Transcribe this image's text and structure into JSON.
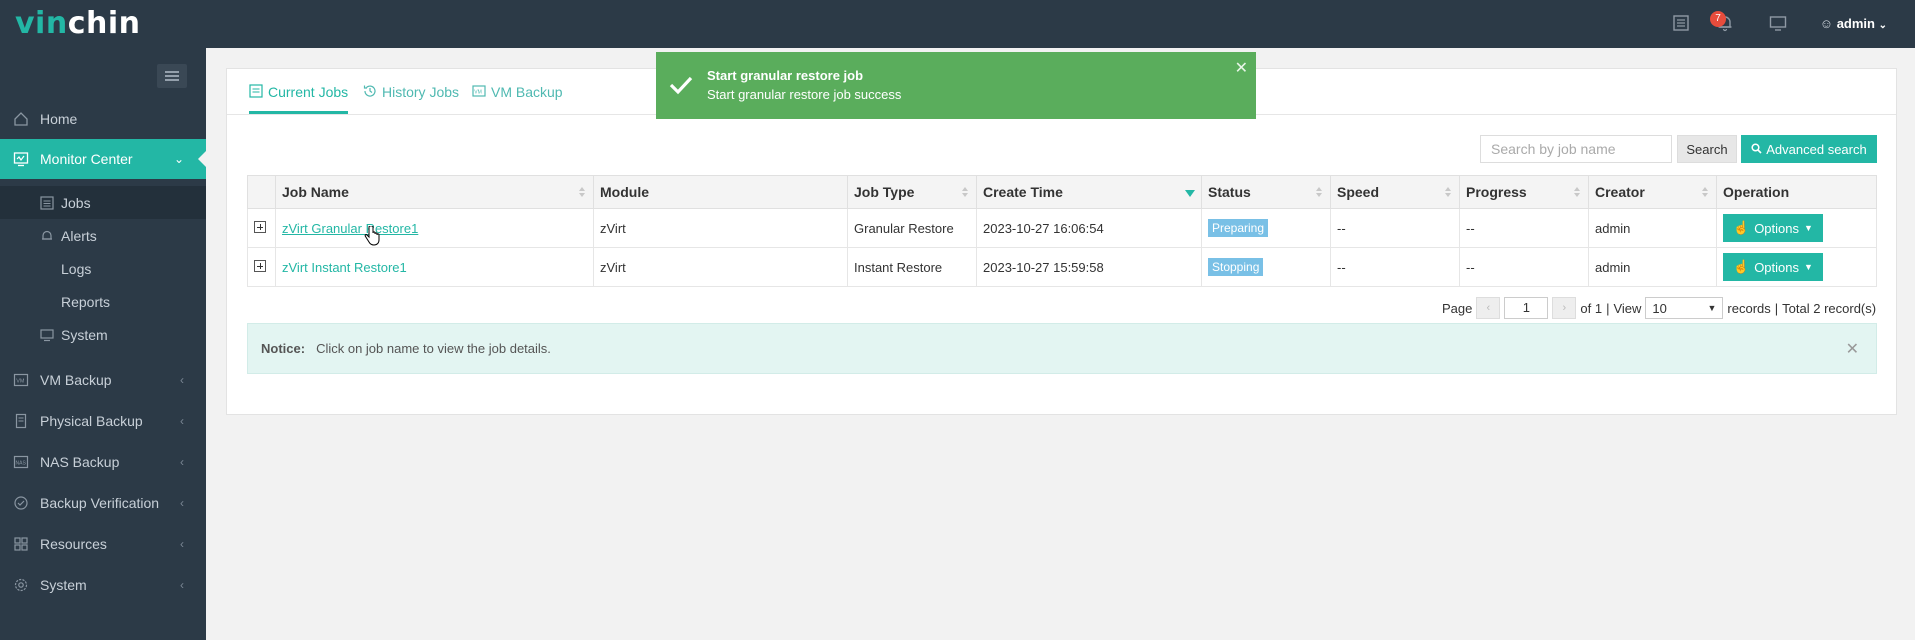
{
  "brand": {
    "part1": "vin",
    "part2": "chin"
  },
  "topbar": {
    "notification_count": "7",
    "user": "admin"
  },
  "sidebar": {
    "items": [
      {
        "label": "Home",
        "icon": "home-icon"
      },
      {
        "label": "Monitor Center",
        "icon": "monitor-icon",
        "active": true
      },
      {
        "label": "VM Backup",
        "icon": "vm-icon"
      },
      {
        "label": "Physical Backup",
        "icon": "server-icon"
      },
      {
        "label": "NAS Backup",
        "icon": "nas-icon"
      },
      {
        "label": "Backup Verification",
        "icon": "verify-icon"
      },
      {
        "label": "Resources",
        "icon": "resources-icon"
      },
      {
        "label": "System",
        "icon": "gear-icon"
      }
    ],
    "subitems": [
      {
        "label": "Jobs",
        "active": true
      },
      {
        "label": "Alerts"
      },
      {
        "label": "Logs"
      },
      {
        "label": "Reports"
      },
      {
        "label": "System"
      }
    ]
  },
  "tabs": [
    {
      "label": "Current Jobs",
      "active": true
    },
    {
      "label": "History Jobs"
    },
    {
      "label": "VM Backup"
    }
  ],
  "search": {
    "placeholder": "Search by job name",
    "button": "Search",
    "advanced": "Advanced search"
  },
  "table": {
    "headers": [
      "Job Name",
      "Module",
      "Job Type",
      "Create Time",
      "Status",
      "Speed",
      "Progress",
      "Creator",
      "Operation"
    ],
    "rows": [
      {
        "job_name": "zVirt Granular Restore1",
        "module": "zVirt",
        "job_type": "Granular Restore",
        "create_time": "2023-10-27 16:06:54",
        "status": "Preparing",
        "speed": "--",
        "progress": "--",
        "creator": "admin",
        "operation": "Options"
      },
      {
        "job_name": "zVirt Instant Restore1",
        "module": "zVirt",
        "job_type": "Instant Restore",
        "create_time": "2023-10-27 15:59:58",
        "status": "Stopping",
        "speed": "--",
        "progress": "--",
        "creator": "admin",
        "operation": "Options"
      }
    ]
  },
  "pager": {
    "page_label": "Page",
    "page": "1",
    "of": "of 1",
    "view_label": "View",
    "view": "10",
    "records": "records",
    "total": "Total 2 record(s)"
  },
  "notice": {
    "label": "Notice:",
    "text": "Click on job name to view the job details."
  },
  "toast": {
    "title": "Start granular restore job",
    "message": "Start granular restore job success"
  },
  "colors": {
    "accent": "#23b7a5",
    "sidebar": "#2c3a47",
    "toast": "#5aad5c",
    "status": "#79c0e6"
  }
}
